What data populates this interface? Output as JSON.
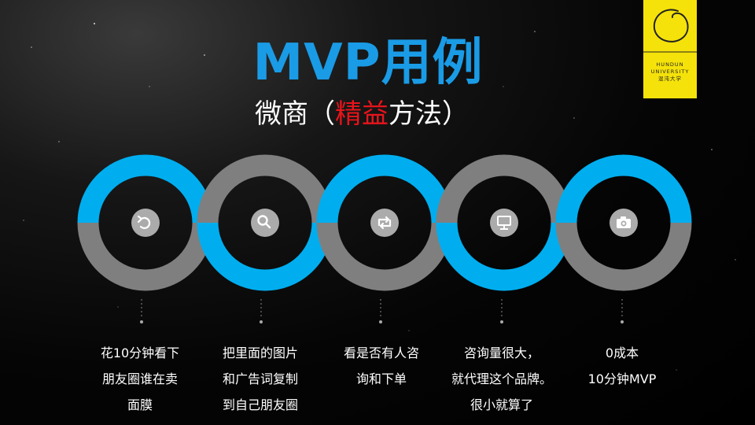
{
  "slide": {
    "title": "MVP用例",
    "subtitle": {
      "prefix": "微商（",
      "accent": "精益",
      "suffix": "方法）"
    },
    "logo": {
      "line1": "HUNDUN",
      "line2": "UNIVERSITY",
      "line3": "混沌大学"
    },
    "colors": {
      "blue": "#00aeef",
      "gray": "#7f7f7f",
      "title_blue": "#1a9be6",
      "accent_red": "#e8141b",
      "logo_yellow": "#f5e20a"
    }
  },
  "steps": [
    {
      "icon": "undo-icon",
      "lines": [
        "花10分钟看下",
        "朋友圈谁在卖",
        "面膜"
      ]
    },
    {
      "icon": "search-icon",
      "lines": [
        "把里面的图片",
        "和广告词复制",
        "到自己朋友圈"
      ]
    },
    {
      "icon": "repost-icon",
      "lines": [
        "看是否有人咨",
        "询和下单"
      ]
    },
    {
      "icon": "monitor-icon",
      "lines": [
        "咨询量很大，",
        "就代理这个品牌。",
        "很小就算了"
      ]
    },
    {
      "icon": "camera-icon",
      "lines": [
        "0成本",
        "10分钟MVP"
      ]
    }
  ]
}
